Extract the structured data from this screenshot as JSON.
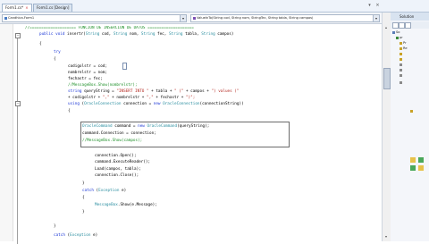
{
  "tabs": [
    {
      "label": "Form1.cs*",
      "active": true
    },
    {
      "label": "Form1.cs [Design]",
      "active": false
    }
  ],
  "nav": {
    "class_combo": "Candhica.Form1",
    "member_combo": "ValueInTo(String cod, String nom, StringTec, String tabla, String campos)"
  },
  "solution_panel": {
    "title": "Solution",
    "items": [
      "So",
      "pr",
      "Pr",
      "Re",
      "",
      "",
      "",
      "",
      "",
      ""
    ]
  },
  "code": {
    "l1": "//==================== FUNCION DE INSERCION DE DATOS ====================",
    "l2_kw": "public void",
    "l2_rest": " insertr(",
    "l2_t1": "String",
    "l2_p1": " cod, ",
    "l2_t2": "String",
    "l2_p2": " nom, ",
    "l2_t3": "String",
    "l2_p3": " fec, ",
    "l2_t4": "String",
    "l2_p4": " tabla, ",
    "l2_t5": "String",
    "l2_p5": " campos)",
    "l3": "{",
    "l4": "try",
    "l5": "{",
    "l6": "codigolstr = cod;",
    "l7": "nombrelstr = nom;",
    "l8": "fechastr = fec;",
    "l9": "//MessageBox.Show(nombrelstr);",
    "l10_kw": "string",
    "l10_a": " queryString = ",
    "l10_s1": "\"INSERT INTO \"",
    "l10_b": " + tabla + ",
    "l10_s2": "\" (\"",
    "l10_c": " + campos + ",
    "l10_s3": "\") values (\"",
    "l11_a": "+ codigolstr + ",
    "l11_s1": "\",\"",
    "l11_b": " + nombrelstr + ",
    "l11_s2": "\",\"",
    "l11_c": " + fechastr + ",
    "l11_s3": "\")\";",
    "l12_kw": "using",
    "l12_a": " (",
    "l12_t": "OracleConnection",
    "l12_b": " connection = ",
    "l12_kw2": "new",
    "l12_t2": " OracleConnection",
    "l12_c": "(connectionString))",
    "l13": "{",
    "l14_t": "OracleCommand",
    "l14_a": " command = ",
    "l14_kw": "new",
    "l14_t2": " OracleCommand",
    "l14_b": "(queryString);",
    "l15": "command.Connection = connection;",
    "l16": "//MessageBox.Show(campos);",
    "l17": "connection.Open();",
    "l18": "command.ExecuteReader();",
    "l19": "Load(campos, tabla);",
    "l20": "connection.Close();",
    "l21": "}",
    "l22_kw": "catch",
    "l22_a": " (",
    "l22_t": "Exception",
    "l22_b": " e)",
    "l23": "{",
    "l24_t": "MessageBox",
    "l24_a": ".Show(e.Message);",
    "l25": "}",
    "l26": "}",
    "l27_kw": "catch",
    "l27_a": " (",
    "l27_t": "Exception",
    "l27_b": " e)"
  }
}
